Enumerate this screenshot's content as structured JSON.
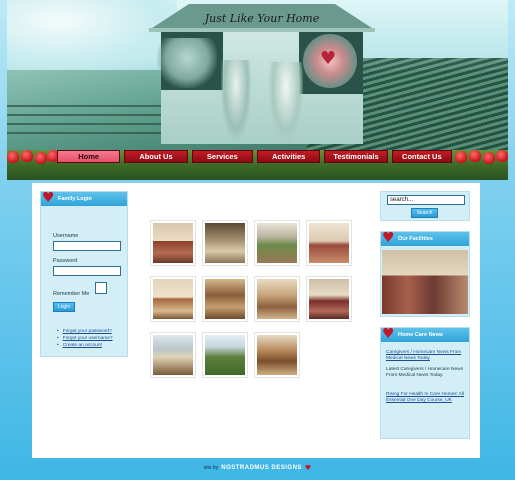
{
  "header": {
    "title": "Just Like Your Home"
  },
  "nav": {
    "items": [
      {
        "label": "Home",
        "active": true
      },
      {
        "label": "About Us",
        "active": false
      },
      {
        "label": "Services",
        "active": false
      },
      {
        "label": "Activities",
        "active": false
      },
      {
        "label": "Testimonials",
        "active": false
      },
      {
        "label": "Contact Us",
        "active": false
      }
    ],
    "active_color": "#ea5c77",
    "item_color": "#b0141e"
  },
  "login": {
    "title": "Family Login",
    "username_label": "Username",
    "password_label": "Password",
    "remember_label": "Remember Me",
    "button_label": "Login",
    "links": [
      "Forgot your password?",
      "Forgot your username?",
      "Create an account"
    ]
  },
  "search": {
    "value": "search...",
    "button_label": "Search"
  },
  "facilities": {
    "title": "Our Facilities"
  },
  "news": {
    "title": "Home Care News",
    "items": [
      {
        "link": "Caregivers / Homecare News From Medical News Today",
        "text": "Latest Caregivers / Homecare News From Medical News Today."
      },
      {
        "link": "Rising For Health In Care Homes' All Essential One Day Course, UK",
        "text": ""
      }
    ]
  },
  "gallery": {
    "image_count": 11
  },
  "footer": {
    "prefix": "site by",
    "brand": "NOSTRADMUS DESIGNS",
    "icon": "heart-icon"
  },
  "colors": {
    "header_bg": "#5fc1ea",
    "box_bg": "#d4eef8",
    "link": "#1a4f8f",
    "heart": "#c0182a"
  }
}
